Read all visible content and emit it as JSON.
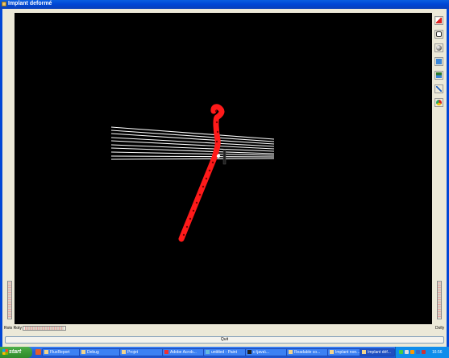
{
  "window": {
    "title": "Implant deformé"
  },
  "viewport": {
    "background": "#000000",
    "implant_color": "#ff1a1a",
    "wire_color": "#ffffff"
  },
  "toolbar": {
    "tools": [
      "pick-icon",
      "rotate-icon",
      "shade-icon",
      "view-icon",
      "camera-icon",
      "pin-icon",
      "render-icon"
    ]
  },
  "labels": {
    "rotx_roty": "Rotx Roty",
    "dolly": "Dolly"
  },
  "quit_button": {
    "label": "Quit"
  },
  "taskbar": {
    "start_label": "start",
    "tasks": [
      "FluxReport",
      "Debug",
      "Projet",
      "Adobe Acrob...",
      "untitled - Paint",
      "c:\\java\\...",
      "Readable co...",
      "Implant non...",
      "Implant déf..."
    ],
    "active_task": "Implant déf...",
    "clock": "16:56"
  }
}
